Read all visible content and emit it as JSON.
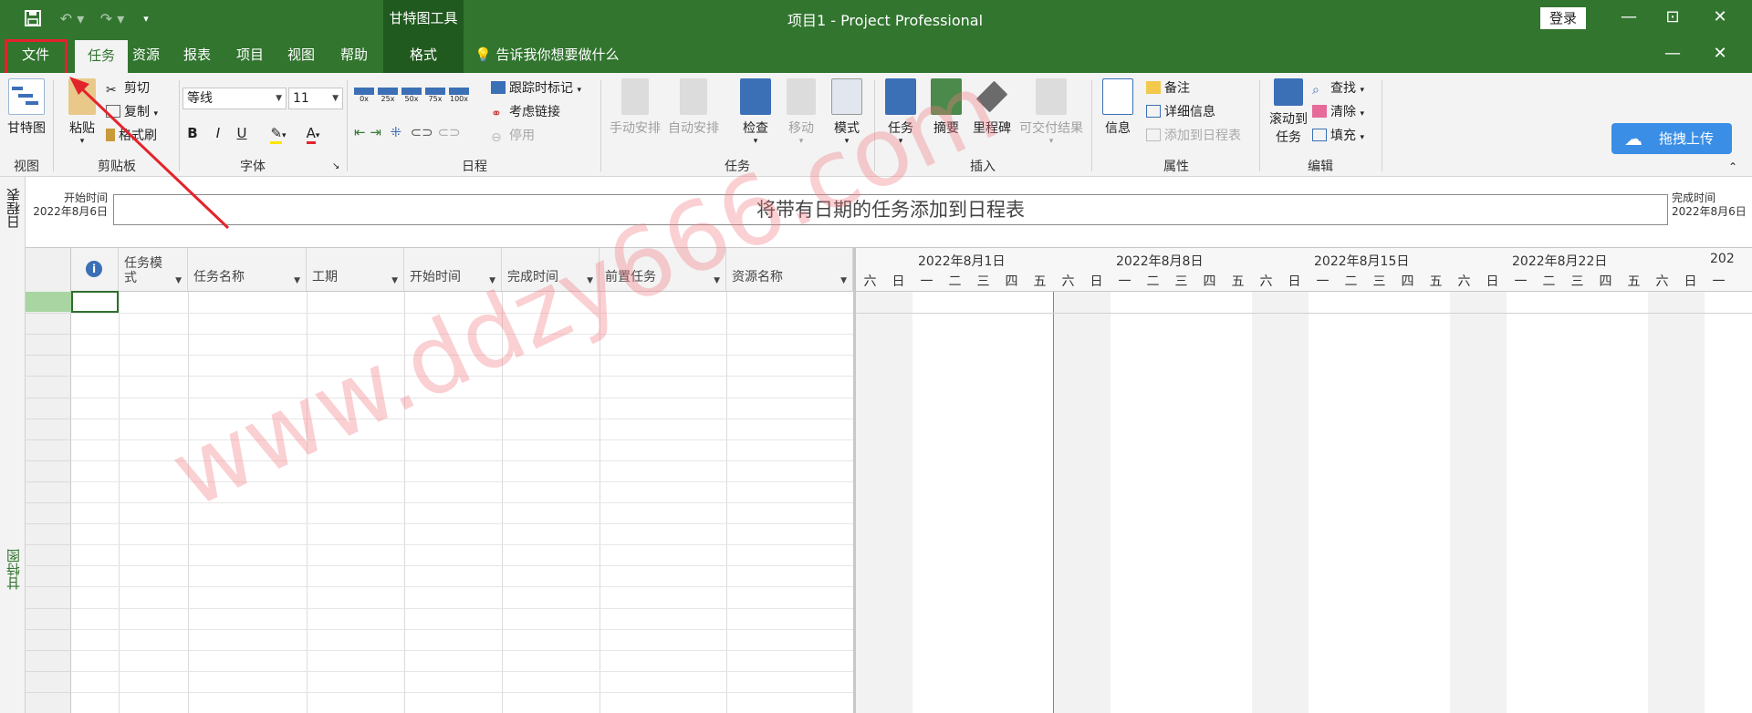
{
  "window": {
    "title": "项目1  -  Project Professional",
    "context_tab_group": "甘特图工具",
    "login_label": "登录"
  },
  "tabs": [
    "文件",
    "任务",
    "资源",
    "报表",
    "项目",
    "视图",
    "帮助",
    "格式"
  ],
  "active_tab": "任务",
  "tell_me": "告诉我你想要做什么",
  "ribbon": {
    "view": {
      "gantt_label": "甘特图",
      "group": "视图"
    },
    "clipboard": {
      "paste": "粘贴",
      "cut": "剪切",
      "copy": "复制",
      "format_painter": "格式刷",
      "group": "剪贴板"
    },
    "font": {
      "font_name": "等线",
      "font_size": "11",
      "bold": "B",
      "italic": "I",
      "underline": "U",
      "font_color": "A",
      "group": "字体"
    },
    "schedule": {
      "percent_labels": [
        "0x",
        "25x",
        "50x",
        "75x",
        "100x"
      ],
      "track": "跟踪时标记",
      "respect_links": "考虑链接",
      "inactivate": "停用",
      "group": "日程"
    },
    "tasks": {
      "manual": "手动安排",
      "auto": "自动安排",
      "inspect": "检查",
      "move": "移动",
      "mode": "模式",
      "group": "任务"
    },
    "insert": {
      "task": "任务",
      "summary": "摘要",
      "milestone": "里程碑",
      "deliverable": "可交付结果",
      "group": "插入"
    },
    "properties": {
      "info": "信息",
      "notes": "备注",
      "details": "详细信息",
      "add_timeline": "添加到日程表",
      "group": "属性"
    },
    "editing": {
      "scroll_to_task_1": "滚动到",
      "scroll_to_task_2": "任务",
      "find": "查找",
      "clear": "清除",
      "fill": "填充",
      "group": "编辑"
    },
    "upload": "拖拽上传"
  },
  "timeline": {
    "side_label": "日程表",
    "start_label": "开始时间",
    "start_date": "2022年8月6日",
    "finish_label": "完成时间",
    "finish_date": "2022年8月6日",
    "placeholder": "将带有日期的任务添加到日程表"
  },
  "gantt": {
    "side_label": "甘特图",
    "columns": [
      "任务模式",
      "任务名称",
      "工期",
      "开始时间",
      "完成时间",
      "前置任务",
      "资源名称"
    ],
    "weeks": [
      "2022年8月1日",
      "2022年8月8日",
      "2022年8月15日",
      "2022年8月22日",
      "202"
    ],
    "days": [
      "六",
      "日",
      "一",
      "二",
      "三",
      "四",
      "五",
      "六",
      "日",
      "一",
      "二",
      "三",
      "四",
      "五",
      "六",
      "日",
      "一",
      "二",
      "三",
      "四",
      "五",
      "六",
      "日",
      "一",
      "二",
      "三",
      "四",
      "五",
      "六",
      "日",
      "一"
    ]
  },
  "watermark": "www.ddzy666.com",
  "colors": {
    "accent": "#31752f",
    "accent_dark": "#215a1f",
    "highlight": "#e3232c"
  }
}
